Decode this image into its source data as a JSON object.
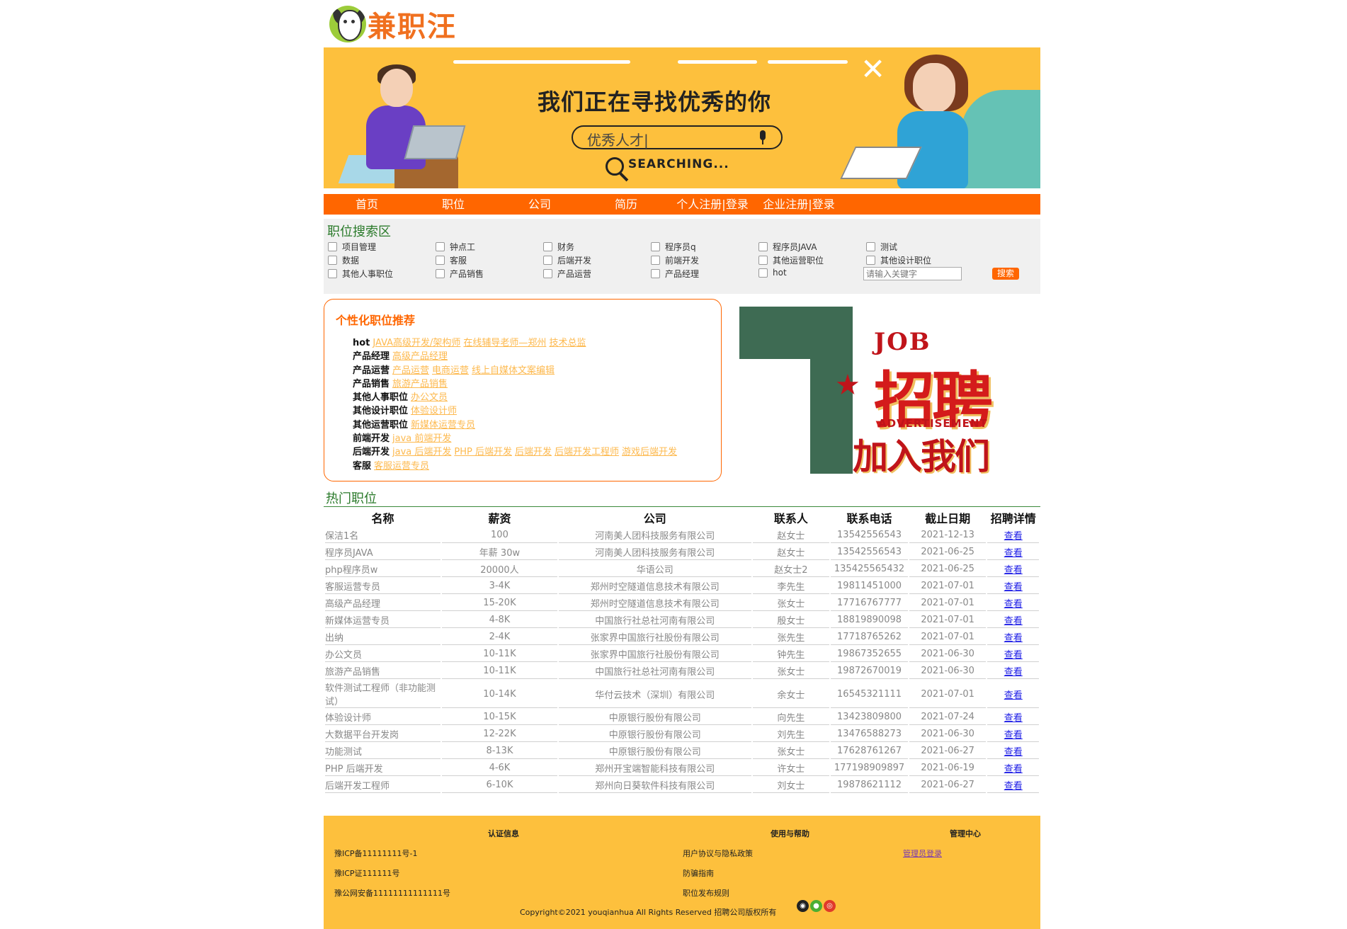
{
  "logo": {
    "text": "兼职汪"
  },
  "banner": {
    "headline": "我们正在寻找优秀的你",
    "search_text": "优秀人才|",
    "searching": "SEARCHING..."
  },
  "nav": [
    "首页",
    "职位",
    "公司",
    "简历",
    "个人注册|登录",
    "企业注册|登录"
  ],
  "search": {
    "title": "职位搜索区",
    "categories": [
      [
        "项目管理",
        "钟点工",
        "财务",
        "程序员q",
        "程序员JAVA",
        "测试"
      ],
      [
        "数据",
        "客服",
        "后端开发",
        "前端开发",
        "其他运营职位",
        "其他设计职位"
      ],
      [
        "其他人事职位",
        "产品销售",
        "产品运营",
        "产品经理",
        "hot"
      ]
    ],
    "keyword_placeholder": "请输入关键字",
    "button": "搜索"
  },
  "recommend": {
    "title": "个性化职位推荐",
    "rows": [
      {
        "category": "hot",
        "links": [
          "JAVA高级开发/架构师",
          "在线辅导老师—郑州",
          "技术总监"
        ]
      },
      {
        "category": "产品经理",
        "links": [
          "高级产品经理"
        ]
      },
      {
        "category": "产品运营",
        "links": [
          "产品运营",
          "电商运营",
          "线上自媒体文案编辑"
        ]
      },
      {
        "category": "产品销售",
        "links": [
          "旅游产品销售"
        ]
      },
      {
        "category": "其他人事职位",
        "links": [
          "办公文员"
        ]
      },
      {
        "category": "其他设计职位",
        "links": [
          "体验设计师"
        ]
      },
      {
        "category": "其他运营职位",
        "links": [
          "新媒体运营专员"
        ]
      },
      {
        "category": "前端开发",
        "links": [
          "java 前端开发"
        ]
      },
      {
        "category": "后端开发",
        "links": [
          "java 后端开发",
          "PHP 后端开发",
          "后端开发",
          "后端开发工程师",
          "游戏后端开发"
        ]
      },
      {
        "category": "客服",
        "links": [
          "客服运营专员"
        ]
      }
    ]
  },
  "recruit_image": {
    "job": "JOB",
    "main": "招聘",
    "sub": "ADVERTISEMENT",
    "join": "加入我们"
  },
  "hot": {
    "title": "热门职位",
    "headers": [
      "名称",
      "薪资",
      "公司",
      "联系人",
      "联系电话",
      "截止日期",
      "招聘详情"
    ],
    "rows": [
      [
        "保洁1名",
        "100",
        "河南美人团科技服务有限公司",
        "赵女士",
        "13542556543",
        "2021-12-13",
        "查看"
      ],
      [
        "程序员JAVA",
        "年薪 30w",
        "河南美人团科技服务有限公司",
        "赵女士",
        "13542556543",
        "2021-06-25",
        "查看"
      ],
      [
        "php程序员w",
        "20000人",
        "华语公司",
        "赵女士2",
        "135425565432",
        "2021-06-25",
        "查看"
      ],
      [
        "客服运营专员",
        "3-4K",
        "郑州时空隧道信息技术有限公司",
        "李先生",
        "19811451000",
        "2021-07-01",
        "查看"
      ],
      [
        "高级产品经理",
        "15-20K",
        "郑州时空隧道信息技术有限公司",
        "张女士",
        "17716767777",
        "2021-07-01",
        "查看"
      ],
      [
        "新媒体运营专员",
        "4-8K",
        "中国旅行社总社河南有限公司",
        "殷女士",
        "18819890098",
        "2021-07-01",
        "查看"
      ],
      [
        "出纳",
        "2-4K",
        "张家界中国旅行社股份有限公司",
        "张先生",
        "17718765262",
        "2021-07-01",
        "查看"
      ],
      [
        "办公文员",
        "10-11K",
        "张家界中国旅行社股份有限公司",
        "钟先生",
        "19867352655",
        "2021-06-30",
        "查看"
      ],
      [
        "旅游产品销售",
        "10-11K",
        "中国旅行社总社河南有限公司",
        "张女士",
        "19872670019",
        "2021-06-30",
        "查看"
      ],
      [
        "软件测试工程师（非功能测试）",
        "10-14K",
        "华付云技术（深圳）有限公司",
        "余女士",
        "16545321111",
        "2021-07-01",
        "查看"
      ],
      [
        "体验设计师",
        "10-15K",
        "中原银行股份有限公司",
        "向先生",
        "13423809800",
        "2021-07-24",
        "查看"
      ],
      [
        "大数据平台开发岗",
        "12-22K",
        "中原银行股份有限公司",
        "刘先生",
        "13476588273",
        "2021-06-30",
        "查看"
      ],
      [
        "功能测试",
        "8-13K",
        "中原银行股份有限公司",
        "张女士",
        "17628761267",
        "2021-06-27",
        "查看"
      ],
      [
        "PHP 后端开发",
        "4-6K",
        "郑州开宝端智能科技有限公司",
        "许女士",
        "177198909897",
        "2021-06-19",
        "查看"
      ],
      [
        "后端开发工程师",
        "6-10K",
        "郑州向日葵软件科技有限公司",
        "刘女士",
        "19878621112",
        "2021-06-27",
        "查看"
      ]
    ]
  },
  "footer": {
    "cert_title": "认证信息",
    "help_title": "使用与帮助",
    "admin_title": "管理中心",
    "cert": [
      "豫ICP备11111111号-1",
      "豫ICP证111111号",
      "豫公网安备11111111111111号"
    ],
    "help": [
      "用户协议与隐私政策",
      "防骗指南",
      "职位发布规则"
    ],
    "admin_login": "管理员登录",
    "copyright": "Copyright©2021 youqianhua All Rights Reserved 招聘公司版权所有"
  }
}
